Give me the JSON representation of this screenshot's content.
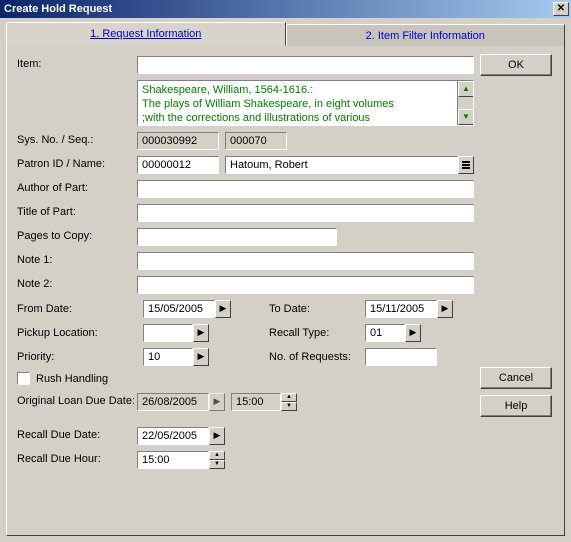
{
  "window": {
    "title": "Create Hold Request"
  },
  "tabs": {
    "tab1": "1. Request Information",
    "tab2": "2. Item Filter Information"
  },
  "labels": {
    "item": "Item:",
    "sysno": "Sys. No. / Seq.:",
    "patron": "Patron ID / Name:",
    "author": "Author of Part:",
    "title": "Title of Part:",
    "pages": "Pages to Copy:",
    "note1": "Note 1:",
    "note2": "Note 2:",
    "from_date": "From Date:",
    "to_date": "To Date:",
    "pickup": "Pickup Location:",
    "recall_type": "Recall Type:",
    "priority": "Priority:",
    "no_requests": "No. of Requests:",
    "rush": "Rush Handling",
    "orig_due": "Original Loan Due Date:",
    "recall_due_date": "Recall Due Date:",
    "recall_due_hour": "Recall Due Hour:"
  },
  "fields": {
    "item": "",
    "item_desc_line1": "Shakespeare, William, 1564-1616.:",
    "item_desc_line2": "The plays of William Shakespeare, in eight volumes",
    "item_desc_line3": ";with the corrections and illustrations of various",
    "sysno": "000030992",
    "seq": "000070",
    "patron_id": "00000012",
    "patron_name": "Hatoum, Robert",
    "author": "",
    "title": "",
    "pages": "",
    "note1": "",
    "note2": "",
    "from_date": "15/05/2005",
    "to_date": "15/11/2005",
    "pickup": "",
    "recall_type": "01",
    "priority": "10",
    "no_requests": "",
    "orig_due_date": "26/08/2005",
    "orig_due_time": "15:00",
    "recall_due_date": "22/05/2005",
    "recall_due_hour": "15:00"
  },
  "buttons": {
    "ok": "OK",
    "cancel": "Cancel",
    "help": "Help"
  }
}
